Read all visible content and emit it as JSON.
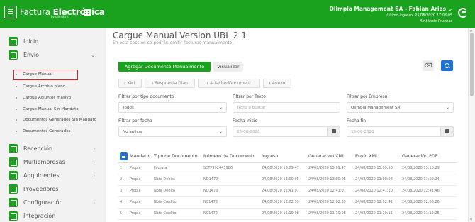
{
  "header": {
    "brand_light": "Factura ",
    "brand_bold": "Electrónica",
    "brand_sub": "by olimpia it",
    "user_name": "Olimpia Management SA - Fabian Arias ⌄",
    "last_login": "Último ingreso: 25/08/2020 17:03:05",
    "environment": "Ambiente Pruebas"
  },
  "sidebar": {
    "inicio": "Inicio",
    "envio": "Envío",
    "sub_items": [
      "Cargue Manual",
      "Cargue Archivo plano",
      "Cargue Adjuntos masivo",
      "Cargue Manual Sin Mandato",
      "Documentos Generados Sin Mandato",
      "Documentos Generados"
    ],
    "recepcion": "Recepción",
    "multiempresas": "Multiempresas",
    "adquirientes": "Adquirientes",
    "proveedores": "Proveedores",
    "configuracion": "Configuración",
    "integracion": "Integración"
  },
  "page": {
    "title": "Cargue Manual Version UBL 2.1",
    "description": "En esta sección se podrán emitir facturas manualmente."
  },
  "actions": {
    "add_manual": "Agregar Documento Manualmente",
    "view": "Visualizar",
    "xml": "XML",
    "respuesta_dian": "Respuesta Dian",
    "attached_document": "AttachedDocument",
    "anexo": "Anexo"
  },
  "filters": {
    "tipo_label": "Filtrar por tipo documento",
    "tipo_value": "Todos",
    "texto_label": "Filtrar por Texto",
    "texto_placeholder": "Texto a buscar",
    "empresa_label": "Filtrar por Empresa",
    "empresa_value": "Olimpia Management SA",
    "fecha_label": "Filtrar por fecha",
    "fecha_value": "No aplicar",
    "inicio_label": "Fecha inicio",
    "inicio_value": "26-08-2020",
    "fin_label": "Fecha fin",
    "fin_value": "26-08-2020"
  },
  "table": {
    "headers": [
      "",
      "Mandato",
      "Tipo de Documento",
      "Número de Documento",
      "Ingreso",
      "Generación XML",
      "Envío XML",
      "Generación PDF"
    ],
    "rows": [
      [
        "1",
        "Propia",
        "Factura",
        "SETP992445986",
        "24/08/2020 15:09:47",
        "24/08/2020 15:09:47",
        "24/08/2020 15:09:50",
        "24/08/2020 15:10:29"
      ],
      [
        "2",
        "Propia",
        "Nota Debito",
        "ND1472",
        "24/08/2020 13:00:05",
        "24/08/2020 13:00:05",
        "24/08/2020 13:00:08",
        "24/08/2020 13:00:24"
      ],
      [
        "3",
        "Propia",
        "Nota Debito",
        "ND1473",
        "24/08/2020 12:41:07",
        "24/08/2020 12:41:07",
        "24/08/2020 12:41:10",
        "24/08/2020 12:41:46"
      ],
      [
        "4",
        "Propia",
        "Nota Credito",
        "NC1473",
        "24/08/2020 12:02:39",
        "24/08/2020 12:02:39",
        "24/08/2020 12:02:41",
        "24/08/2020 12:03:26"
      ],
      [
        "5",
        "Propia",
        "Nota Credito",
        "NC1472",
        "24/08/2020 11:19:08",
        "24/08/2020 11:19:08",
        "24/08/2020 11:19:11",
        "24/08/2020 11:19:25"
      ]
    ]
  }
}
